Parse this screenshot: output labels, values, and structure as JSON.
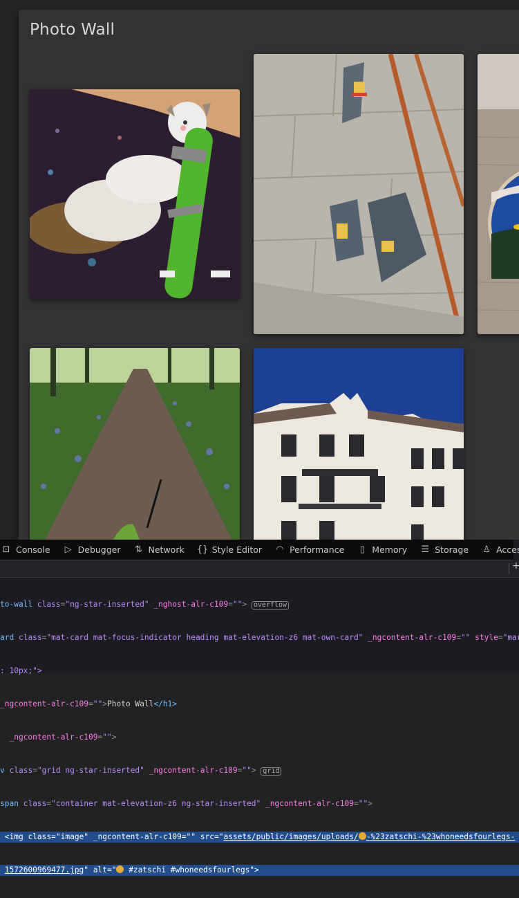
{
  "page": {
    "title": "Photo Wall"
  },
  "photos": [
    {
      "alt": "cat hugging green toy",
      "tag": "#zatschi #whoneedsfourlegs"
    },
    {
      "alt": "stickers on wall with copper poles"
    },
    {
      "alt": "round painted coaster with bee"
    },
    {
      "alt": "forest path with bluebells"
    },
    {
      "alt": "white building against blue sky"
    }
  ],
  "devtools": {
    "tabs": [
      {
        "label": "Console",
        "icon": "console-icon"
      },
      {
        "label": "Debugger",
        "icon": "debugger-icon"
      },
      {
        "label": "Network",
        "icon": "network-icon"
      },
      {
        "label": "Style Editor",
        "icon": "style-editor-icon"
      },
      {
        "label": "Performance",
        "icon": "performance-icon"
      },
      {
        "label": "Memory",
        "icon": "memory-icon"
      },
      {
        "label": "Storage",
        "icon": "storage-icon"
      },
      {
        "label": "Accessibility",
        "icon": "accessibility-icon"
      }
    ],
    "add_rule": "+",
    "code": {
      "l1_tag": "to-wall",
      "l1_a1": "class",
      "l1_v1": "\"ng-star-inserted\"",
      "l1_a2": "_nghost-alr-c109",
      "l1_v2": "\"\"",
      "l1_badge": "overflow",
      "l2_tag": "ard",
      "l2_a1": "class",
      "l2_v1": "\"mat-card mat-focus-indicator heading mat-elevation-z6 mat-own-card\"",
      "l2_a2": "_ngcontent-alr-c109",
      "l2_v2": "\"\"",
      "l2_a3": "style",
      "l2_v3": "\"margi",
      "l3_text": ": 10px;\">",
      "l4_a": "_ngcontent-alr-c109",
      "l4_v": "\"\"",
      "l4_text": "Photo Wall",
      "l4_close": "</h1>",
      "l5_a": "_ngcontent-alr-c109",
      "l5_v": "\"\"",
      "l6_tag": "v",
      "l6_a1": "class",
      "l6_v1": "\"grid ng-star-inserted\"",
      "l6_a2": "_ngcontent-alr-c109",
      "l6_v2": "\"\"",
      "l6_badge": "grid",
      "l7_tag": "span",
      "l7_a1": "class",
      "l7_v1": "\"container mat-elevation-z6 ng-star-inserted\"",
      "l7_a2": "_ngcontent-alr-c109",
      "l7_v2": "\"\"",
      "l8_tag": "<img",
      "l8_a1": "class",
      "l8_v1": "\"image\"",
      "l8_a2": "_ngcontent-alr-c109",
      "l8_v2": "\"\"",
      "l8_a3": "src",
      "l8_src": "assets/public/images/uploads/",
      "l8_src2": "-%23zatschi-%23whoneedsfourlegs-",
      "l9_src": "1572600969477.jpg",
      "l9_a": "alt",
      "l9_alt": " #zatschi #whoneedsfourlegs\">"
    }
  }
}
